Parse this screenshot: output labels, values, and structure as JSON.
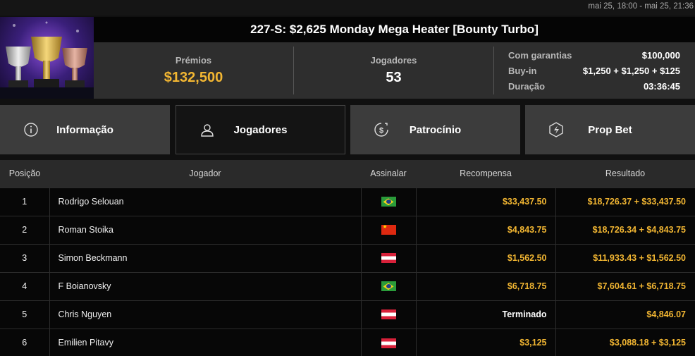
{
  "header": {
    "date_range": "mai 25, 18:00 - mai 25, 21:36"
  },
  "tournament": {
    "title": "227-S: $2,625 Monday Mega Heater [Bounty Turbo]",
    "prizes_label": "Prémios",
    "prizes_value": "$132,500",
    "players_label": "Jogadores",
    "players_value": "53",
    "details": [
      {
        "label": "Com garantias",
        "value": "$100,000"
      },
      {
        "label": "Buy-in",
        "value": "$1,250 + $1,250 + $125"
      },
      {
        "label": "Duração",
        "value": "03:36:45"
      }
    ]
  },
  "tabs": [
    {
      "label": "Informação",
      "icon": "info-icon",
      "active": false
    },
    {
      "label": "Jogadores",
      "icon": "user-icon",
      "active": true
    },
    {
      "label": "Patrocínio",
      "icon": "dollar-coin-icon",
      "active": false
    },
    {
      "label": "Prop Bet",
      "icon": "lightning-hexagon-icon",
      "active": false
    }
  ],
  "table": {
    "headers": [
      "Posição",
      "Jogador",
      "Assinalar",
      "Recompensa",
      "Resultado"
    ],
    "rows": [
      {
        "position": "1",
        "player": "Rodrigo Selouan",
        "flag": "brazil",
        "reward": "$33,437.50",
        "result": "$18,726.37 + $33,437.50"
      },
      {
        "position": "2",
        "player": "Roman Stoika",
        "flag": "china",
        "reward": "$4,843.75",
        "result": "$18,726.34 + $4,843.75"
      },
      {
        "position": "3",
        "player": "Simon Beckmann",
        "flag": "austria",
        "reward": "$1,562.50",
        "result": "$11,933.43 + $1,562.50"
      },
      {
        "position": "4",
        "player": "F Boianovsky",
        "flag": "brazil",
        "reward": "$6,718.75",
        "result": "$7,604.61 + $6,718.75"
      },
      {
        "position": "5",
        "player": "Chris Nguyen",
        "flag": "austria",
        "reward": "Terminado",
        "result": "$4,846.07"
      },
      {
        "position": "6",
        "player": "Emilien Pitavy",
        "flag": "austria",
        "reward": "$3,125",
        "result": "$3,088.18 + $3,125"
      }
    ]
  },
  "colors": {
    "accent_gold": "#f2b632",
    "background": "#101010",
    "panel": "#2e2e2e"
  }
}
